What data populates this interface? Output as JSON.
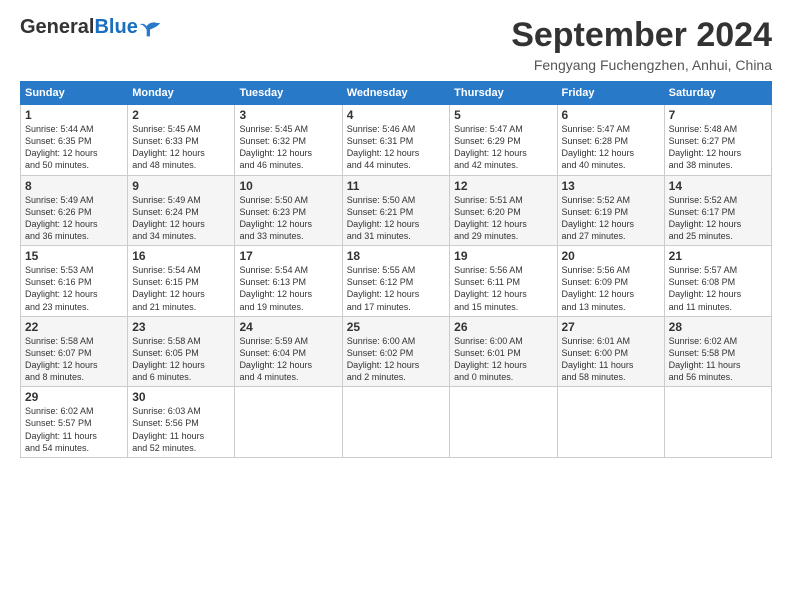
{
  "logo": {
    "general": "General",
    "blue": "Blue"
  },
  "title": "September 2024",
  "location": "Fengyang Fuchengzhen, Anhui, China",
  "headers": [
    "Sunday",
    "Monday",
    "Tuesday",
    "Wednesday",
    "Thursday",
    "Friday",
    "Saturday"
  ],
  "weeks": [
    [
      {
        "day": "1",
        "info": "Sunrise: 5:44 AM\nSunset: 6:35 PM\nDaylight: 12 hours\nand 50 minutes."
      },
      {
        "day": "2",
        "info": "Sunrise: 5:45 AM\nSunset: 6:33 PM\nDaylight: 12 hours\nand 48 minutes."
      },
      {
        "day": "3",
        "info": "Sunrise: 5:45 AM\nSunset: 6:32 PM\nDaylight: 12 hours\nand 46 minutes."
      },
      {
        "day": "4",
        "info": "Sunrise: 5:46 AM\nSunset: 6:31 PM\nDaylight: 12 hours\nand 44 minutes."
      },
      {
        "day": "5",
        "info": "Sunrise: 5:47 AM\nSunset: 6:29 PM\nDaylight: 12 hours\nand 42 minutes."
      },
      {
        "day": "6",
        "info": "Sunrise: 5:47 AM\nSunset: 6:28 PM\nDaylight: 12 hours\nand 40 minutes."
      },
      {
        "day": "7",
        "info": "Sunrise: 5:48 AM\nSunset: 6:27 PM\nDaylight: 12 hours\nand 38 minutes."
      }
    ],
    [
      {
        "day": "8",
        "info": "Sunrise: 5:49 AM\nSunset: 6:26 PM\nDaylight: 12 hours\nand 36 minutes."
      },
      {
        "day": "9",
        "info": "Sunrise: 5:49 AM\nSunset: 6:24 PM\nDaylight: 12 hours\nand 34 minutes."
      },
      {
        "day": "10",
        "info": "Sunrise: 5:50 AM\nSunset: 6:23 PM\nDaylight: 12 hours\nand 33 minutes."
      },
      {
        "day": "11",
        "info": "Sunrise: 5:50 AM\nSunset: 6:21 PM\nDaylight: 12 hours\nand 31 minutes."
      },
      {
        "day": "12",
        "info": "Sunrise: 5:51 AM\nSunset: 6:20 PM\nDaylight: 12 hours\nand 29 minutes."
      },
      {
        "day": "13",
        "info": "Sunrise: 5:52 AM\nSunset: 6:19 PM\nDaylight: 12 hours\nand 27 minutes."
      },
      {
        "day": "14",
        "info": "Sunrise: 5:52 AM\nSunset: 6:17 PM\nDaylight: 12 hours\nand 25 minutes."
      }
    ],
    [
      {
        "day": "15",
        "info": "Sunrise: 5:53 AM\nSunset: 6:16 PM\nDaylight: 12 hours\nand 23 minutes."
      },
      {
        "day": "16",
        "info": "Sunrise: 5:54 AM\nSunset: 6:15 PM\nDaylight: 12 hours\nand 21 minutes."
      },
      {
        "day": "17",
        "info": "Sunrise: 5:54 AM\nSunset: 6:13 PM\nDaylight: 12 hours\nand 19 minutes."
      },
      {
        "day": "18",
        "info": "Sunrise: 5:55 AM\nSunset: 6:12 PM\nDaylight: 12 hours\nand 17 minutes."
      },
      {
        "day": "19",
        "info": "Sunrise: 5:56 AM\nSunset: 6:11 PM\nDaylight: 12 hours\nand 15 minutes."
      },
      {
        "day": "20",
        "info": "Sunrise: 5:56 AM\nSunset: 6:09 PM\nDaylight: 12 hours\nand 13 minutes."
      },
      {
        "day": "21",
        "info": "Sunrise: 5:57 AM\nSunset: 6:08 PM\nDaylight: 12 hours\nand 11 minutes."
      }
    ],
    [
      {
        "day": "22",
        "info": "Sunrise: 5:58 AM\nSunset: 6:07 PM\nDaylight: 12 hours\nand 8 minutes."
      },
      {
        "day": "23",
        "info": "Sunrise: 5:58 AM\nSunset: 6:05 PM\nDaylight: 12 hours\nand 6 minutes."
      },
      {
        "day": "24",
        "info": "Sunrise: 5:59 AM\nSunset: 6:04 PM\nDaylight: 12 hours\nand 4 minutes."
      },
      {
        "day": "25",
        "info": "Sunrise: 6:00 AM\nSunset: 6:02 PM\nDaylight: 12 hours\nand 2 minutes."
      },
      {
        "day": "26",
        "info": "Sunrise: 6:00 AM\nSunset: 6:01 PM\nDaylight: 12 hours\nand 0 minutes."
      },
      {
        "day": "27",
        "info": "Sunrise: 6:01 AM\nSunset: 6:00 PM\nDaylight: 11 hours\nand 58 minutes."
      },
      {
        "day": "28",
        "info": "Sunrise: 6:02 AM\nSunset: 5:58 PM\nDaylight: 11 hours\nand 56 minutes."
      }
    ],
    [
      {
        "day": "29",
        "info": "Sunrise: 6:02 AM\nSunset: 5:57 PM\nDaylight: 11 hours\nand 54 minutes."
      },
      {
        "day": "30",
        "info": "Sunrise: 6:03 AM\nSunset: 5:56 PM\nDaylight: 11 hours\nand 52 minutes."
      },
      {
        "day": "",
        "info": ""
      },
      {
        "day": "",
        "info": ""
      },
      {
        "day": "",
        "info": ""
      },
      {
        "day": "",
        "info": ""
      },
      {
        "day": "",
        "info": ""
      }
    ]
  ]
}
